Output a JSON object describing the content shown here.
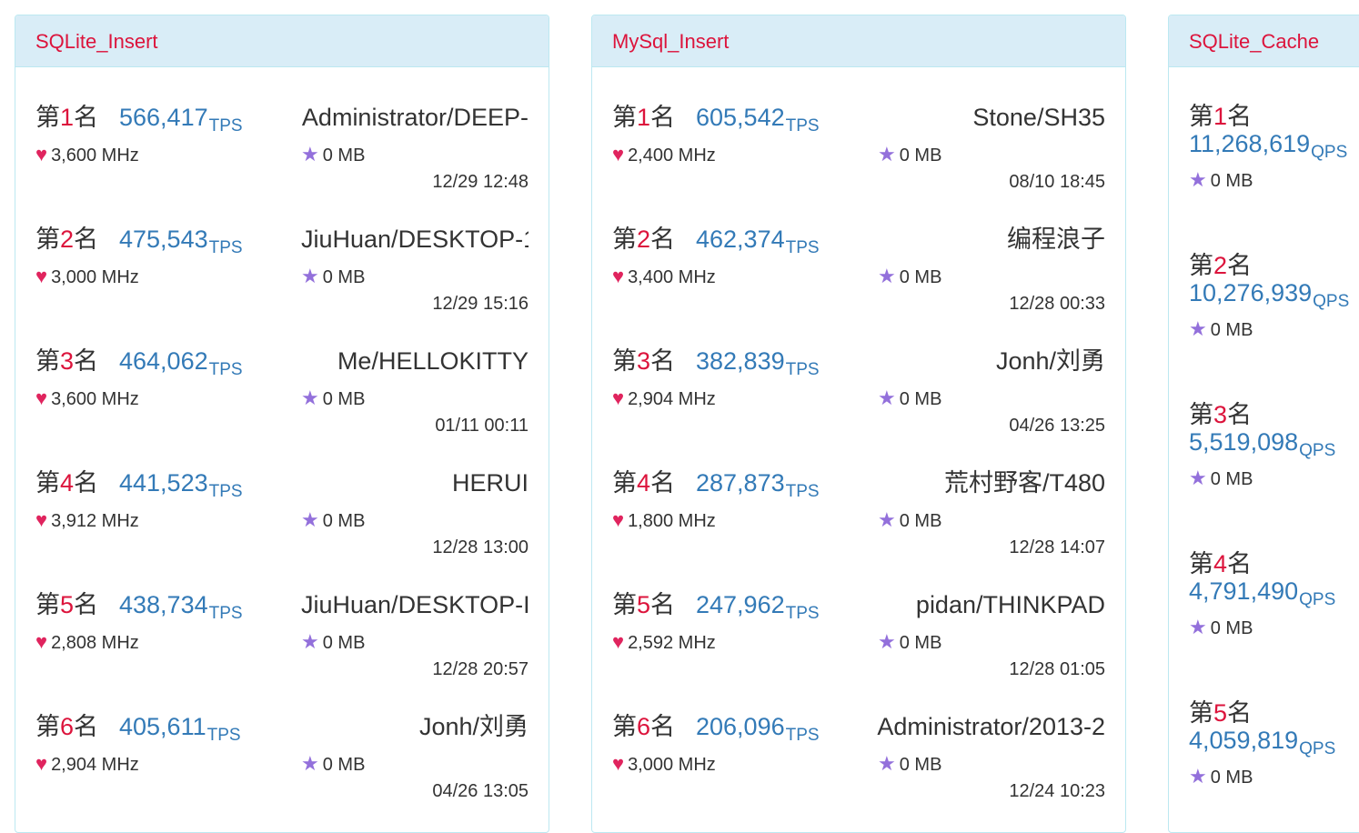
{
  "panels": [
    {
      "title": "SQLite_Insert",
      "unit": "TPS",
      "entries": [
        {
          "prefix": "第",
          "rank": "1",
          "suffix": "名",
          "score": "566,417",
          "user": "Administrator/DEEP-",
          "cpu": "3,600 MHz",
          "mem": "0 MB",
          "time": "12/29 12:48"
        },
        {
          "prefix": "第",
          "rank": "2",
          "suffix": "名",
          "score": "475,543",
          "user": "JiuHuan/DESKTOP-1",
          "cpu": "3,000 MHz",
          "mem": "0 MB",
          "time": "12/29 15:16"
        },
        {
          "prefix": "第",
          "rank": "3",
          "suffix": "名",
          "score": "464,062",
          "user": "Me/HELLOKITTY",
          "cpu": "3,600 MHz",
          "mem": "0 MB",
          "time": "01/11 00:11"
        },
        {
          "prefix": "第",
          "rank": "4",
          "suffix": "名",
          "score": "441,523",
          "user": "HERUI",
          "cpu": "3,912 MHz",
          "mem": "0 MB",
          "time": "12/28 13:00"
        },
        {
          "prefix": "第",
          "rank": "5",
          "suffix": "名",
          "score": "438,734",
          "user": "JiuHuan/DESKTOP-I",
          "cpu": "2,808 MHz",
          "mem": "0 MB",
          "time": "12/28 20:57"
        },
        {
          "prefix": "第",
          "rank": "6",
          "suffix": "名",
          "score": "405,611",
          "user": "Jonh/刘勇",
          "cpu": "2,904 MHz",
          "mem": "0 MB",
          "time": "04/26 13:05"
        }
      ]
    },
    {
      "title": "MySql_Insert",
      "unit": "TPS",
      "entries": [
        {
          "prefix": "第",
          "rank": "1",
          "suffix": "名",
          "score": "605,542",
          "user": "Stone/SH35",
          "cpu": "2,400 MHz",
          "mem": "0 MB",
          "time": "08/10 18:45"
        },
        {
          "prefix": "第",
          "rank": "2",
          "suffix": "名",
          "score": "462,374",
          "user": "编程浪子",
          "cpu": "3,400 MHz",
          "mem": "0 MB",
          "time": "12/28 00:33"
        },
        {
          "prefix": "第",
          "rank": "3",
          "suffix": "名",
          "score": "382,839",
          "user": "Jonh/刘勇",
          "cpu": "2,904 MHz",
          "mem": "0 MB",
          "time": "04/26 13:25"
        },
        {
          "prefix": "第",
          "rank": "4",
          "suffix": "名",
          "score": "287,873",
          "user": "荒村野客/T480",
          "cpu": "1,800 MHz",
          "mem": "0 MB",
          "time": "12/28 14:07"
        },
        {
          "prefix": "第",
          "rank": "5",
          "suffix": "名",
          "score": "247,962",
          "user": "pidan/THINKPAD",
          "cpu": "2,592 MHz",
          "mem": "0 MB",
          "time": "12/28 01:05"
        },
        {
          "prefix": "第",
          "rank": "6",
          "suffix": "名",
          "score": "206,096",
          "user": "Administrator/2013-2",
          "cpu": "3,000 MHz",
          "mem": "0 MB",
          "time": "12/24 10:23"
        }
      ]
    },
    {
      "title": "SQLite_Cache",
      "unit": "QPS",
      "entries": [
        {
          "prefix": "第",
          "rank": "1",
          "suffix": "名",
          "score": "11,268,619",
          "mem": "0 MB"
        },
        {
          "prefix": "第",
          "rank": "2",
          "suffix": "名",
          "score": "10,276,939",
          "mem": "0 MB"
        },
        {
          "prefix": "第",
          "rank": "3",
          "suffix": "名",
          "score": "5,519,098",
          "mem": "0 MB"
        },
        {
          "prefix": "第",
          "rank": "4",
          "suffix": "名",
          "score": "4,791,490",
          "mem": "0 MB"
        },
        {
          "prefix": "第",
          "rank": "5",
          "suffix": "名",
          "score": "4,059,819",
          "mem": "0 MB"
        }
      ]
    }
  ],
  "icons": {
    "cpu": "heart-icon",
    "mem": "star-icon"
  },
  "colors": {
    "accent": "#dc143c",
    "score": "#337ab7",
    "heart": "#e0245e",
    "star": "#9370db",
    "header_bg": "#d9edf7"
  }
}
